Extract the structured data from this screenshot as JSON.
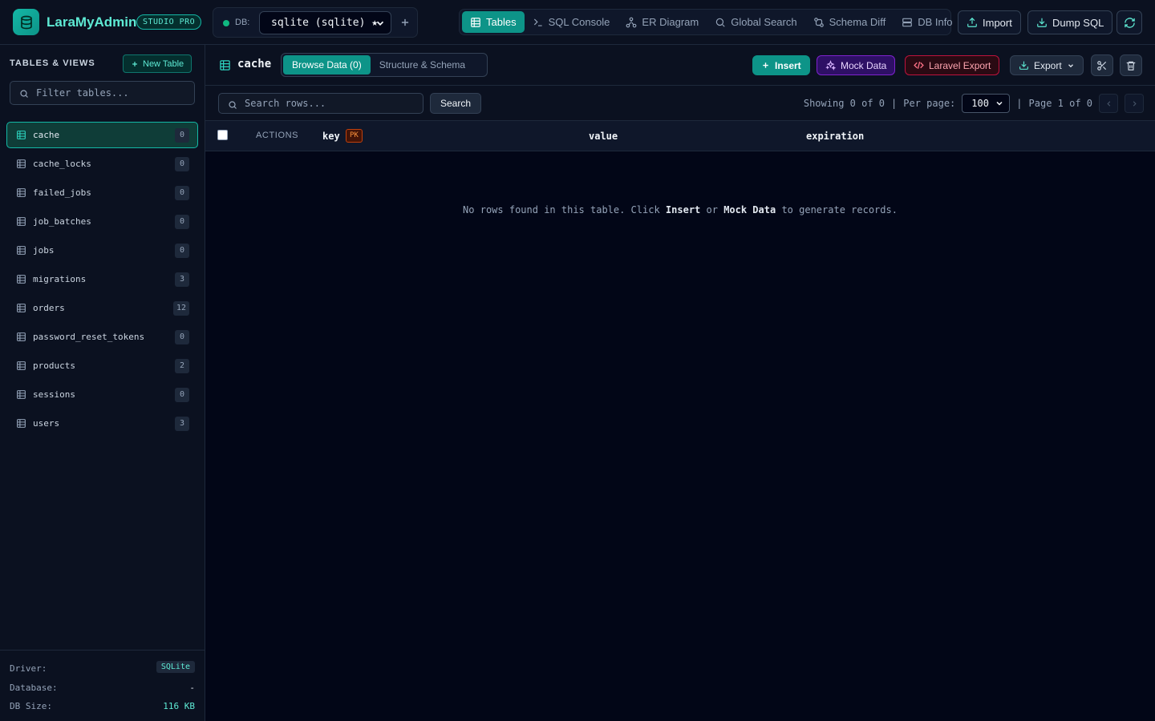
{
  "app": {
    "name": "LaraMyAdmin",
    "edition_badge": "STUDIO PRO"
  },
  "connection": {
    "label": "DB:",
    "selected": "sqlite (sqlite) ★",
    "status_color": "#10b981"
  },
  "nav": {
    "items": [
      {
        "label": "Tables",
        "icon": "table-icon",
        "active": true
      },
      {
        "label": "SQL Console",
        "icon": "terminal-icon",
        "active": false
      },
      {
        "label": "ER Diagram",
        "icon": "diagram-icon",
        "active": false
      },
      {
        "label": "Global Search",
        "icon": "search-icon",
        "active": false
      },
      {
        "label": "Schema Diff",
        "icon": "diff-icon",
        "active": false
      },
      {
        "label": "DB Info",
        "icon": "database-icon",
        "active": false
      }
    ],
    "import_label": "Import",
    "dump_label": "Dump SQL"
  },
  "sidebar": {
    "heading": "TABLES & VIEWS",
    "new_table_label": "New Table",
    "filter_placeholder": "Filter tables...",
    "tables": [
      {
        "name": "cache",
        "count": "0",
        "active": true
      },
      {
        "name": "cache_locks",
        "count": "0",
        "active": false
      },
      {
        "name": "failed_jobs",
        "count": "0",
        "active": false
      },
      {
        "name": "job_batches",
        "count": "0",
        "active": false
      },
      {
        "name": "jobs",
        "count": "0",
        "active": false
      },
      {
        "name": "migrations",
        "count": "3",
        "active": false
      },
      {
        "name": "orders",
        "count": "12",
        "active": false
      },
      {
        "name": "password_reset_tokens",
        "count": "0",
        "active": false
      },
      {
        "name": "products",
        "count": "2",
        "active": false
      },
      {
        "name": "sessions",
        "count": "0",
        "active": false
      },
      {
        "name": "users",
        "count": "3",
        "active": false
      }
    ],
    "footer": {
      "driver_label": "Driver:",
      "driver_value": "SQLite",
      "database_label": "Database:",
      "database_value": "-",
      "size_label": "DB Size:",
      "size_value": "116 KB"
    }
  },
  "main": {
    "table_name": "cache",
    "tabs": [
      {
        "label": "Browse Data (0)",
        "active": true
      },
      {
        "label": "Structure & Schema",
        "active": false
      }
    ],
    "actions": {
      "insert": "Insert",
      "mock": "Mock Data",
      "laravel_export": "Laravel Export",
      "export": "Export"
    },
    "search_placeholder": "Search rows...",
    "search_button": "Search",
    "pagination": {
      "showing": "Showing 0 of 0",
      "sep1": "|",
      "per_page_label": "Per page:",
      "per_page_value": "100",
      "sep2": "|",
      "page_text": "Page 1 of 0"
    },
    "columns": {
      "actions": "ACTIONS",
      "list": [
        "key",
        "value",
        "expiration"
      ],
      "pk_badge": "PK"
    },
    "empty": {
      "prefix": "No rows found in this table. Click ",
      "insert": "Insert",
      "middle": " or ",
      "mock": "Mock Data",
      "suffix": " to generate records."
    }
  },
  "colors": {
    "accent": "#0d9488",
    "accent_light": "#5eead4",
    "background": "#020617",
    "panel": "#0b1120",
    "mock_accent": "#7e22ce",
    "laravel_accent": "#be123c",
    "pk_accent": "#fb923c"
  }
}
